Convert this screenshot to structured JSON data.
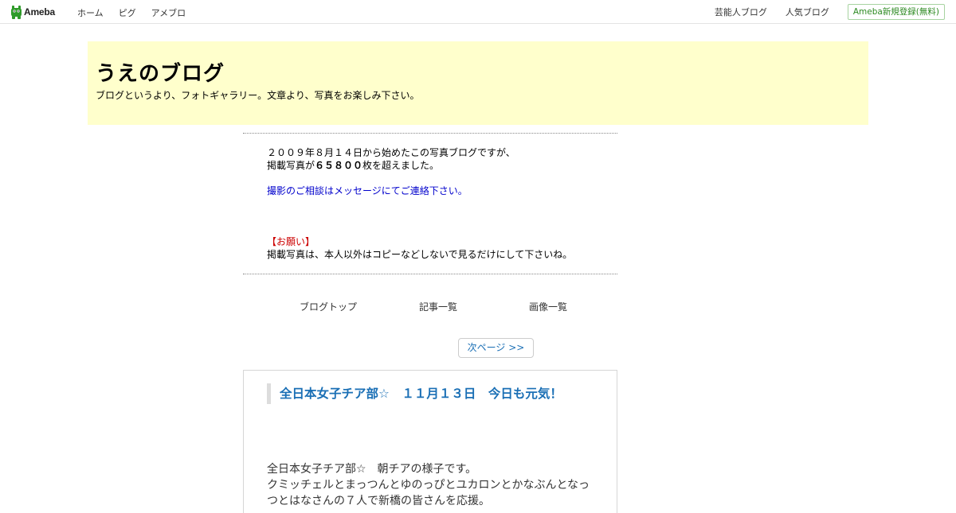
{
  "topbar": {
    "logo_text": "Ameba",
    "nav_left": [
      "ホーム",
      "ピグ",
      "アメブロ"
    ],
    "nav_right": [
      "芸能人ブログ",
      "人気ブログ"
    ],
    "register_label": "Ameba新規登録(無料)"
  },
  "blog": {
    "title": "うえのブログ",
    "description": "ブログというより、フォトギャラリー。文章より、写真をお楽しみ下さい。"
  },
  "message": {
    "line1": "２００９年８月１４日から始めたこの写真ブログですが、",
    "line2_prefix": "掲載写真が",
    "line2_count": "６５８００",
    "line2_suffix": "枚を超えました。",
    "contact": "撮影のご相談はメッセージにてご連絡下さい。",
    "notice_heading": "【お願い】",
    "notice_text": "掲載写真は、本人以外はコピーなどしないで見るだけにして下さいね。"
  },
  "menu": {
    "items": [
      "ブログトップ",
      "記事一覧",
      "画像一覧"
    ]
  },
  "pager": {
    "next_label": "次ページ >>"
  },
  "article": {
    "title": "全日本女子チア部☆　１１月１３日　今日も元気！",
    "body_lines": [
      "全日本女子チア部☆　朝チアの様子です。",
      "クミッチェルとまっつんとゆのっぴとユカロンとかなぶんとなっ",
      "つとはなさんの７人で新橋の皆さんを応援。"
    ]
  },
  "colors": {
    "header_bg": "#ffffcc",
    "link_blue": "#1a6fb5",
    "register_green": "#2d8a22",
    "notice_red": "#cc0000",
    "contact_blue": "#0000cc"
  }
}
